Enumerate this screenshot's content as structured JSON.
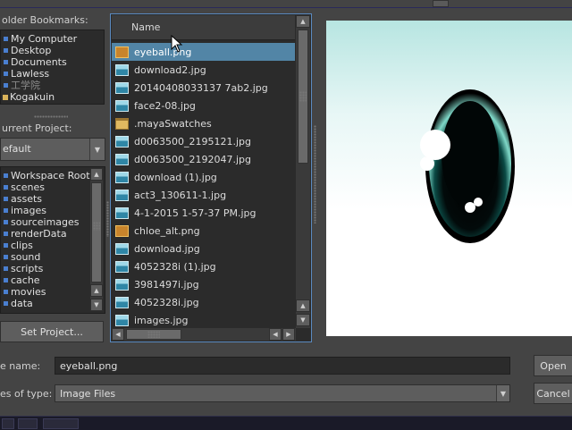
{
  "bookmarks": {
    "label": "older Bookmarks:",
    "items": [
      {
        "label": "My Computer",
        "icon": "drive-icon"
      },
      {
        "label": "Desktop",
        "icon": "drive-icon"
      },
      {
        "label": "Documents",
        "icon": "drive-icon"
      },
      {
        "label": "Lawless",
        "icon": "drive-icon"
      },
      {
        "label": "工学院",
        "icon": "drive-icon",
        "disabled": true
      },
      {
        "label": "Kogakuin",
        "icon": "folder-icon"
      }
    ]
  },
  "project": {
    "label": "urrent Project:",
    "selected": "efault",
    "items": [
      "Workspace Root",
      "scenes",
      "assets",
      "images",
      "sourceimages",
      "renderData",
      "clips",
      "sound",
      "scripts",
      "cache",
      "movies",
      "data"
    ],
    "set_button": "Set Project..."
  },
  "file_list": {
    "column_header": "Name",
    "files": [
      {
        "name": "eyeball.png",
        "type": "png",
        "selected": true
      },
      {
        "name": "download2.jpg",
        "type": "jpg"
      },
      {
        "name": "20140408033137 7ab2.jpg",
        "type": "jpg"
      },
      {
        "name": "face2-08.jpg",
        "type": "jpg"
      },
      {
        "name": ".mayaSwatches",
        "type": "folder"
      },
      {
        "name": "d0063500_2195121.jpg",
        "type": "jpg"
      },
      {
        "name": "d0063500_2192047.jpg",
        "type": "jpg"
      },
      {
        "name": "download (1).jpg",
        "type": "jpg"
      },
      {
        "name": "act3_130611-1.jpg",
        "type": "jpg"
      },
      {
        "name": "4-1-2015 1-57-37 PM.jpg",
        "type": "jpg"
      },
      {
        "name": "chloe_alt.png",
        "type": "png"
      },
      {
        "name": "download.jpg",
        "type": "jpg"
      },
      {
        "name": "4052328i (1).jpg",
        "type": "jpg"
      },
      {
        "name": "3981497i.jpg",
        "type": "jpg"
      },
      {
        "name": "4052328i.jpg",
        "type": "jpg"
      },
      {
        "name": "images.jpg",
        "type": "jpg"
      }
    ]
  },
  "filename": {
    "label": "e name:",
    "value": "eyeball.png"
  },
  "filetype": {
    "label": "es of type:",
    "value": "Image Files"
  },
  "buttons": {
    "open": "Open",
    "cancel": "Cancel"
  },
  "colors": {
    "selection": "#5285a6",
    "focus_border": "#5a8ac0",
    "background": "#444444",
    "panel": "#2b2b2b"
  },
  "icons": {
    "sort_up": "▲",
    "sort_down": "▼",
    "left": "◀",
    "right": "▶",
    "drop": "▼"
  }
}
